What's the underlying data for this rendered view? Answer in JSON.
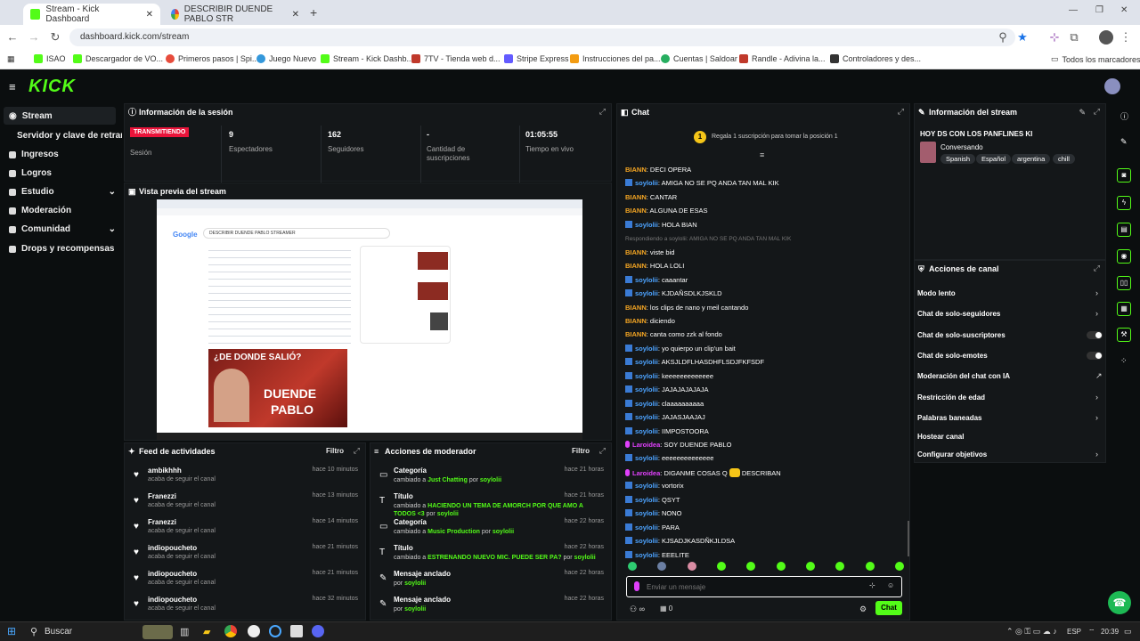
{
  "browser": {
    "tabs": [
      "Stream - Kick Dashboard",
      "DESCRIBIR DUENDE PABLO STR"
    ],
    "new_tab": "+",
    "url": "dashboard.kick.com/stream",
    "bookmarks": [
      "ISAO",
      "Descargador de VO...",
      "Primeros pasos | Spi...",
      "Juego Nuevo",
      "Stream - Kick Dashb...",
      "7TV - Tienda web d...",
      "Stripe Express",
      "Instrucciones del pa...",
      "Cuentas | Saldoar",
      "Randle - Adivina la...",
      "Controladores y des..."
    ],
    "bookmarks_right": "Todos los marcadores"
  },
  "kick": {
    "logo": "KICK"
  },
  "sidebar": {
    "items": [
      "Stream",
      "Servidor y clave de retransmisión",
      "Ingresos",
      "Logros",
      "Estudio",
      "Moderación",
      "Comunidad",
      "Drops y recompensas"
    ]
  },
  "session": {
    "title": "Información de la sesión",
    "badge": "TRANSMITIENDO",
    "session_label": "Sesión",
    "viewers_value": "9",
    "viewers_label": "Espectadores",
    "followers_value": "162",
    "followers_label": "Seguidores",
    "subs_value": "-",
    "subs_label_1": "Cantidad de",
    "subs_label_2": "suscripciones",
    "live_value": "01:05:55",
    "live_label": "Tiempo en vivo"
  },
  "preview": {
    "title": "Vista previa del stream",
    "thumb_line1": "¿DE DONDE SALIÓ?",
    "thumb_line2": "DUENDE",
    "thumb_line3": "PABLO",
    "search_text": "DESCRIBIR DUENDE PABLO STREAMER"
  },
  "feed": {
    "title": "Feed de actividades",
    "filter": "Filtro",
    "rows": [
      {
        "name": "ambikhhh",
        "sub": "acaba de seguir el canal",
        "time": "hace 10 minutos"
      },
      {
        "name": "Franezzi",
        "sub": "acaba de seguir el canal",
        "time": "hace 13 minutos"
      },
      {
        "name": "Franezzi",
        "sub": "acaba de seguir el canal",
        "time": "hace 14 minutos"
      },
      {
        "name": "indiopoucheto",
        "sub": "acaba de seguir el canal",
        "time": "hace 21 minutos"
      },
      {
        "name": "indiopoucheto",
        "sub": "acaba de seguir el canal",
        "time": "hace 21 minutos"
      },
      {
        "name": "indiopoucheto",
        "sub": "acaba de seguir el canal",
        "time": "hace 32 minutos"
      }
    ]
  },
  "modactions": {
    "title": "Acciones de moderador",
    "filter": "Filtro",
    "rows": [
      {
        "name": "Categoría",
        "pre": "cambiado a ",
        "val": "Just Chatting",
        "mid": " por ",
        "user": "soylolii",
        "time": "hace 21 horas"
      },
      {
        "name": "Título",
        "pre": "cambiado a ",
        "val": "HACIENDO UN TEMA DE AMORCH POR QUE AMO A TODOS <3",
        "mid": " por ",
        "user": "soylolii",
        "time": "hace 21 horas"
      },
      {
        "name": "Categoría",
        "pre": "cambiado a ",
        "val": "Music Production",
        "mid": " por ",
        "user": "soylolii",
        "time": "hace 22 horas"
      },
      {
        "name": "Título",
        "pre": "cambiado a ",
        "val": "ESTRENANDO NUEVO MIC. PUEDE SER PA?",
        "mid": " por ",
        "user": "soylolii",
        "time": "hace 22 horas"
      },
      {
        "name": "Mensaje anclado",
        "pre": "por ",
        "val": "",
        "mid": "",
        "user": "soylolii",
        "time": "hace 22 horas"
      },
      {
        "name": "Mensaje anclado",
        "pre": "por ",
        "val": "",
        "mid": "",
        "user": "soylolii",
        "time": "hace 22 horas"
      }
    ]
  },
  "chat": {
    "title": "Chat",
    "gift": "Regala 1 suscripción para tomar la posición 1",
    "lines": [
      {
        "u": "BIANN",
        "m": "DECI OPERA",
        "c": "#f5a623"
      },
      {
        "u": "soylolii",
        "m": "AMIGA NO SE PQ ANDA TAN MAL KIK",
        "c": "#4da3ff",
        "i": true
      },
      {
        "u": "BIANN",
        "m": "CANTAR",
        "c": "#f5a623"
      },
      {
        "u": "BIANN",
        "m": "ALGUNA DE ESAS",
        "c": "#f5a623"
      },
      {
        "u": "soylolii",
        "m": "HOLA BIAN",
        "c": "#4da3ff",
        "i": true
      },
      {
        "u": "",
        "m": "Respondiendo a soylolii: AMIGA NO SE PQ ANDA TAN MAL KIK",
        "c": "#777",
        "r": true
      },
      {
        "u": "BIANN",
        "m": "viste bid",
        "c": "#f5a623"
      },
      {
        "u": "BIANN",
        "m": "HOLA LOLI",
        "c": "#f5a623"
      },
      {
        "u": "soylolii",
        "m": "caaantar",
        "c": "#4da3ff",
        "i": true
      },
      {
        "u": "soylolii",
        "m": "KJDAÑSDLKJSKLD",
        "c": "#4da3ff",
        "i": true
      },
      {
        "u": "BIANN",
        "m": "los clips de nano y meil cantando",
        "c": "#f5a623"
      },
      {
        "u": "BIANN",
        "m": "diciendo",
        "c": "#f5a623"
      },
      {
        "u": "BIANN",
        "m": "canta como zzk al fondo",
        "c": "#f5a623"
      },
      {
        "u": "soylolii",
        "m": "yo quierpo un clip'un bait",
        "c": "#4da3ff",
        "i": true
      },
      {
        "u": "soylolii",
        "m": "AKSJLDFLHASDHFLSDJFKFSDF",
        "c": "#4da3ff",
        "i": true
      },
      {
        "u": "soylolii",
        "m": "keeeeeeeeeeeee",
        "c": "#4da3ff",
        "i": true
      },
      {
        "u": "soylolii",
        "m": "JAJAJAJAJAJA",
        "c": "#4da3ff",
        "i": true
      },
      {
        "u": "soylolii",
        "m": "claaaaaaaaaa",
        "c": "#4da3ff",
        "i": true
      },
      {
        "u": "soylolii",
        "m": "JAJASJAAJAJ",
        "c": "#4da3ff",
        "i": true
      },
      {
        "u": "soylolii",
        "m": "IIMPOSTOORA",
        "c": "#4da3ff",
        "i": true
      },
      {
        "u": "Laroidea",
        "m": "SOY DUENDE PABLO",
        "c": "#e040fb",
        "p": true
      },
      {
        "u": "soylolii",
        "m": "eeeeeeeeeeeeee",
        "c": "#4da3ff",
        "i": true
      },
      {
        "u": "Laroidea",
        "m": "DIGANME COSAS Q",
        "m2": "DESCRIBAN",
        "c": "#e040fb",
        "p": true
      },
      {
        "u": "soylolii",
        "m": "vortorix",
        "c": "#4da3ff",
        "i": true
      },
      {
        "u": "soylolii",
        "m": "QSYT",
        "c": "#4da3ff",
        "i": true
      },
      {
        "u": "soylolii",
        "m": "NONO",
        "c": "#4da3ff",
        "i": true
      },
      {
        "u": "soylolii",
        "m": "PARA",
        "c": "#4da3ff",
        "i": true
      },
      {
        "u": "soylolii",
        "m": "KJSADJKASDÑKJLDSA",
        "c": "#4da3ff",
        "i": true
      },
      {
        "u": "soylolii",
        "m": "EEELITE",
        "c": "#4da3ff",
        "i": true
      }
    ],
    "placeholder": "Enviar un mensaje",
    "send": "Chat",
    "count_left": "∞",
    "count_right": "0"
  },
  "streaminfo": {
    "title": "Información del stream",
    "stream_title": "HOY DS CON LOS PANFLINES KI",
    "category": "Conversando",
    "tags": [
      "Spanish",
      "Español",
      "argentina",
      "chill"
    ]
  },
  "channel": {
    "title": "Acciones de canal",
    "items": [
      "Modo lento",
      "Chat de solo-seguidores",
      "Chat de solo-suscriptores",
      "Chat de solo-emotes",
      "Moderación del chat con IA",
      "Restricción de edad",
      "Palabras baneadas",
      "Hostear canal",
      "Configurar objetivos"
    ]
  },
  "taskbar": {
    "search": "Buscar",
    "lang": "ESP",
    "time": "20:39"
  }
}
